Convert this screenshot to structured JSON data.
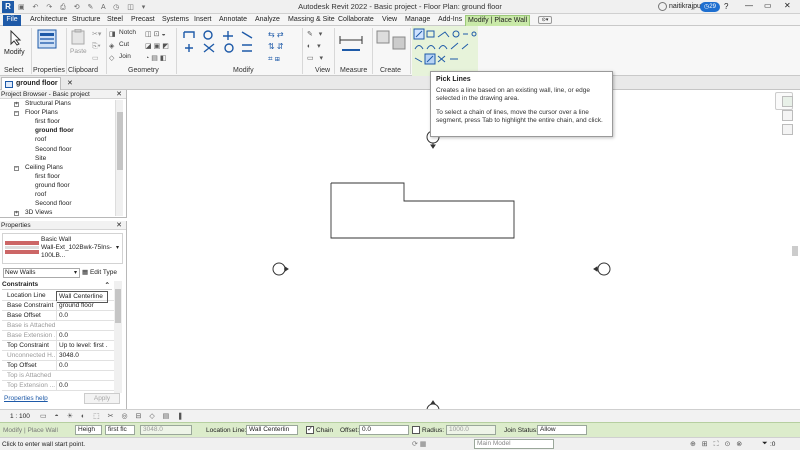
{
  "window": {
    "title": "Autodesk Revit 2022 - Basic project - Floor Plan: ground floor",
    "user": "naitikrajput33",
    "notification_count": "29"
  },
  "menu": {
    "tabs": [
      "File",
      "Architecture",
      "Structure",
      "Steel",
      "Precast",
      "Systems",
      "Insert",
      "Annotate",
      "Analyze",
      "Massing & Site",
      "Collaborate",
      "View",
      "Manage",
      "Add-Ins",
      "Modify | Place Wall"
    ]
  },
  "ribbon": {
    "modify_label": "Modify",
    "select_label": "Select",
    "properties_label": "Properties",
    "clipboard": {
      "label": "Clipboard",
      "paste": "Paste"
    },
    "geometry": {
      "label": "Geometry",
      "notch": "Notch",
      "cut": "Cut",
      "join": "Join"
    },
    "modify_panel_label": "Modify",
    "view_label": "View",
    "measure_label": "Measure",
    "create_label": "Create"
  },
  "view_tab": {
    "label": "ground floor"
  },
  "browser": {
    "title": "Project Browser - Basic project",
    "items": [
      {
        "label": "Structural Plans",
        "level": 1,
        "toggle": "+"
      },
      {
        "label": "Floor Plans",
        "level": 1,
        "toggle": "−"
      },
      {
        "label": "first floor",
        "level": 2
      },
      {
        "label": "ground floor",
        "level": 2,
        "selected": true
      },
      {
        "label": "roof",
        "level": 2
      },
      {
        "label": "Second floor",
        "level": 2
      },
      {
        "label": "Site",
        "level": 2
      },
      {
        "label": "Ceiling Plans",
        "level": 1,
        "toggle": "−"
      },
      {
        "label": "first floor",
        "level": 2
      },
      {
        "label": "ground floor",
        "level": 2
      },
      {
        "label": "roof",
        "level": 2
      },
      {
        "label": "Second floor",
        "level": 2
      },
      {
        "label": "3D Views",
        "level": 1,
        "toggle": "+"
      }
    ]
  },
  "properties": {
    "title": "Properties",
    "type_family": "Basic Wall",
    "type_name": "Wall-Ext_102Bwk-75Ins-100LB...",
    "instance_select": "New Walls",
    "edit_type": "Edit Type",
    "section": "Constraints",
    "rows": [
      {
        "key": "Location Line",
        "value": "Wall Centerline"
      },
      {
        "key": "Base Constraint",
        "value": "ground floor"
      },
      {
        "key": "Base Offset",
        "value": "0.0"
      },
      {
        "key": "Base is Attached",
        "value": "",
        "disabled": true
      },
      {
        "key": "Base Extension ...",
        "value": "0.0",
        "disabled": true
      },
      {
        "key": "Top Constraint",
        "value": "Up to level: first ..."
      },
      {
        "key": "Unconnected H...",
        "value": "3048.0",
        "disabled": true
      },
      {
        "key": "Top Offset",
        "value": "0.0"
      },
      {
        "key": "Top is Attached",
        "value": "",
        "disabled": true
      },
      {
        "key": "Top Extension ...",
        "value": "0.0",
        "disabled": true
      }
    ],
    "help": "Properties help",
    "apply": "Apply"
  },
  "tooltip": {
    "title": "Pick Lines",
    "body1": "Creates a line based on an existing wall, line, or edge selected in the drawing area.",
    "body2": "To select a chain of lines, move the cursor over a line segment, press Tab to highlight the entire chain, and click."
  },
  "view_control": {
    "scale": "1 : 100"
  },
  "options_bar": {
    "mode": "Modify | Place Wall",
    "height_label": "Heigh",
    "height_target": "first flc",
    "height_value": "3048.0",
    "location_label": "Location Line:",
    "location_value": "Wall Centerlin",
    "chain_label": "Chain",
    "offset_label": "Offset:",
    "offset_value": "0.0",
    "radius_label": "Radius:",
    "radius_value": "1000.0",
    "join_label": "Join Status:",
    "join_value": "Allow"
  },
  "status": {
    "message": "Click to enter wall start point.",
    "model": "Main Model",
    "filter_count": ":0"
  },
  "colors": {
    "file_tab": "#1e5aa8",
    "context_tab": "#c9e9a8",
    "options_bar": "#dceccb"
  }
}
